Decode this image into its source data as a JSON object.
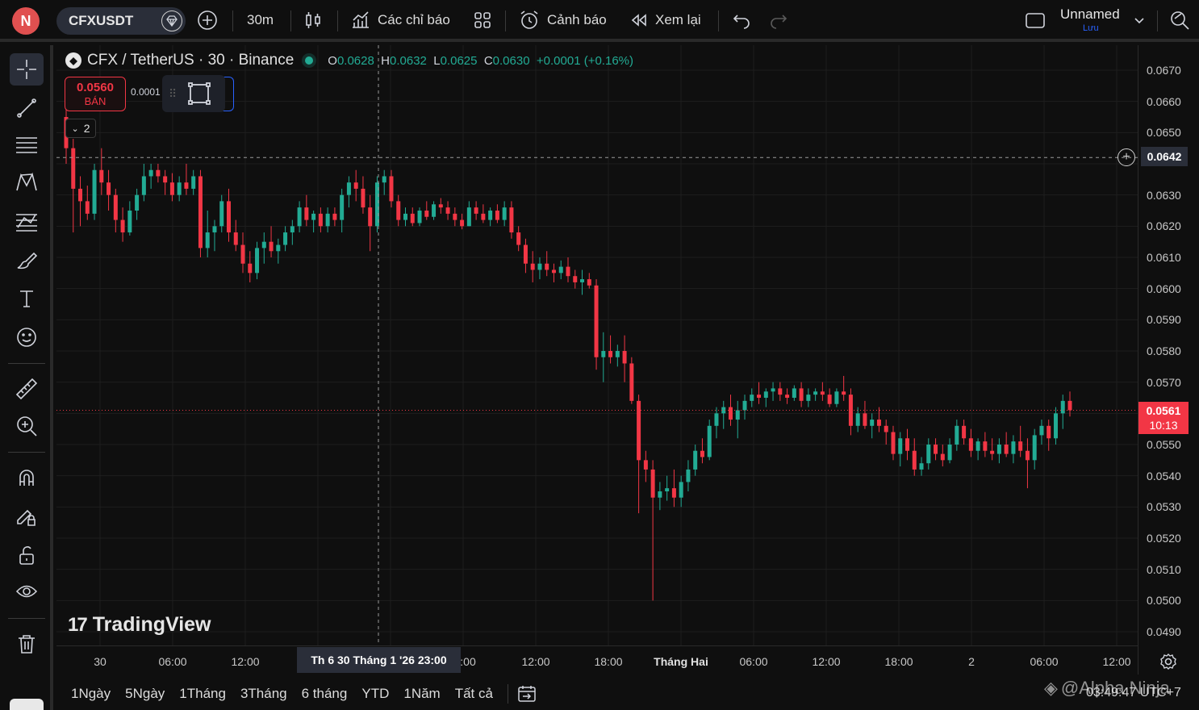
{
  "top_bar": {
    "avatar_letter": "N",
    "symbol": "CFXUSDT",
    "interval": "30m",
    "indicators_label": "Các chỉ báo",
    "alerts_label": "Cảnh báo",
    "replay_label": "Xem lại",
    "layout_name": "Unnamed",
    "layout_save": "Lưu"
  },
  "legend": {
    "title": "CFX / TetherUS · 30 · Binance",
    "o_label": "O",
    "o_value": "0.0628",
    "h_label": "H",
    "h_value": "0.0632",
    "l_label": "L",
    "l_value": "0.0625",
    "c_label": "C",
    "c_value": "0.0630",
    "change": "+0.0001 (+0.16%)"
  },
  "trade_panel": {
    "sell_price": "0.0560",
    "sell_label": "BÁN",
    "spread": "0.0001",
    "collapse_count": "2"
  },
  "watermark": "TradingView",
  "price_axis": {
    "labels": [
      "0.0670",
      "0.0660",
      "0.0650",
      "0.0630",
      "0.0620",
      "0.0610",
      "0.0600",
      "0.0590",
      "0.0580",
      "0.0570",
      "0.0550",
      "0.0540",
      "0.0530",
      "0.0520",
      "0.0510",
      "0.0500",
      "0.0490"
    ],
    "crosshair_price": "0.0642",
    "current_price": "0.0561",
    "countdown": "10:13"
  },
  "time_axis": {
    "labels": [
      "30",
      "06:00",
      "12:00",
      ":00",
      "12:00",
      "18:00",
      "Tháng Hai",
      "06:00",
      "12:00",
      "18:00",
      "2",
      "06:00",
      "12:00"
    ],
    "crosshair_time": "Th 6 30 Tháng 1 '26   23:00"
  },
  "bottom_bar": {
    "ranges": [
      "1Ngày",
      "5Ngày",
      "1Tháng",
      "3Tháng",
      "6 tháng",
      "YTD",
      "1Năm",
      "Tất cả"
    ],
    "clock": "03:49:47 UTC+7",
    "overlay_watermark": "@Alpha Ninja"
  },
  "colors": {
    "up": "#22ab94",
    "down": "#f23645",
    "background": "#0f0f0f",
    "grid": "#1e1e1e"
  },
  "chart_data": {
    "type": "candlestick",
    "interval": "30",
    "ylim": [
      0.049,
      0.0675
    ],
    "crosshair_price": 0.0642,
    "current_price": 0.0561,
    "candles": [
      [
        0.0655,
        0.066,
        0.064,
        0.0645
      ],
      [
        0.0645,
        0.0648,
        0.0618,
        0.0632
      ],
      [
        0.0632,
        0.0636,
        0.062,
        0.0628
      ],
      [
        0.0628,
        0.0633,
        0.0622,
        0.0624
      ],
      [
        0.0624,
        0.064,
        0.0622,
        0.0638
      ],
      [
        0.0638,
        0.0645,
        0.063,
        0.0634
      ],
      [
        0.0634,
        0.0638,
        0.0625,
        0.063
      ],
      [
        0.063,
        0.0632,
        0.0618,
        0.0622
      ],
      [
        0.0622,
        0.0626,
        0.0615,
        0.0618
      ],
      [
        0.0618,
        0.0628,
        0.0617,
        0.0625
      ],
      [
        0.0625,
        0.0632,
        0.0622,
        0.063
      ],
      [
        0.063,
        0.064,
        0.0628,
        0.0636
      ],
      [
        0.0636,
        0.064,
        0.0632,
        0.0638
      ],
      [
        0.0638,
        0.064,
        0.0634,
        0.0636
      ],
      [
        0.0636,
        0.0638,
        0.063,
        0.0634
      ],
      [
        0.0634,
        0.0637,
        0.0628,
        0.063
      ],
      [
        0.063,
        0.0636,
        0.0628,
        0.0634
      ],
      [
        0.0634,
        0.064,
        0.063,
        0.0632
      ],
      [
        0.0632,
        0.0638,
        0.063,
        0.0636
      ],
      [
        0.0636,
        0.0638,
        0.061,
        0.0613
      ],
      [
        0.0613,
        0.0625,
        0.061,
        0.0618
      ],
      [
        0.0618,
        0.0622,
        0.0612,
        0.062
      ],
      [
        0.062,
        0.063,
        0.0618,
        0.0628
      ],
      [
        0.0628,
        0.0632,
        0.0615,
        0.0618
      ],
      [
        0.0618,
        0.0622,
        0.0612,
        0.0614
      ],
      [
        0.0614,
        0.0618,
        0.0605,
        0.0608
      ],
      [
        0.0608,
        0.0612,
        0.0602,
        0.0605
      ],
      [
        0.0605,
        0.0615,
        0.0603,
        0.0613
      ],
      [
        0.0613,
        0.0618,
        0.0608,
        0.0615
      ],
      [
        0.0615,
        0.062,
        0.061,
        0.0612
      ],
      [
        0.0612,
        0.0616,
        0.0608,
        0.0614
      ],
      [
        0.0614,
        0.062,
        0.0612,
        0.0618
      ],
      [
        0.0618,
        0.0622,
        0.0614,
        0.062
      ],
      [
        0.062,
        0.0628,
        0.0618,
        0.0626
      ],
      [
        0.0626,
        0.063,
        0.062,
        0.0622
      ],
      [
        0.0622,
        0.0625,
        0.0618,
        0.0624
      ],
      [
        0.0624,
        0.0626,
        0.0618,
        0.062
      ],
      [
        0.062,
        0.0626,
        0.0618,
        0.0624
      ],
      [
        0.0624,
        0.0626,
        0.062,
        0.0622
      ],
      [
        0.0622,
        0.0632,
        0.0618,
        0.063
      ],
      [
        0.063,
        0.0636,
        0.0626,
        0.0634
      ],
      [
        0.0634,
        0.0638,
        0.0628,
        0.0632
      ],
      [
        0.0632,
        0.0636,
        0.0624,
        0.0626
      ],
      [
        0.0626,
        0.063,
        0.0612,
        0.062
      ],
      [
        0.062,
        0.0636,
        0.0618,
        0.0634
      ],
      [
        0.0634,
        0.0638,
        0.063,
        0.0636
      ],
      [
        0.0636,
        0.0638,
        0.0626,
        0.0628
      ],
      [
        0.0628,
        0.063,
        0.062,
        0.0622
      ],
      [
        0.0622,
        0.0626,
        0.062,
        0.0624
      ],
      [
        0.0624,
        0.0626,
        0.062,
        0.0621
      ],
      [
        0.0621,
        0.0626,
        0.062,
        0.0625
      ],
      [
        0.0625,
        0.0628,
        0.0622,
        0.0623
      ],
      [
        0.0623,
        0.0628,
        0.0622,
        0.0627
      ],
      [
        0.0627,
        0.0629,
        0.0624,
        0.0626
      ],
      [
        0.0626,
        0.0628,
        0.0622,
        0.0624
      ],
      [
        0.0624,
        0.0626,
        0.062,
        0.0622
      ],
      [
        0.0622,
        0.0624,
        0.0619,
        0.062
      ],
      [
        0.062,
        0.0628,
        0.062,
        0.0626
      ],
      [
        0.0626,
        0.0628,
        0.0622,
        0.0624
      ],
      [
        0.0624,
        0.0627,
        0.0621,
        0.0622
      ],
      [
        0.0622,
        0.0626,
        0.062,
        0.0625
      ],
      [
        0.0625,
        0.0627,
        0.0621,
        0.0622
      ],
      [
        0.0622,
        0.0628,
        0.062,
        0.0626
      ],
      [
        0.0626,
        0.0628,
        0.0616,
        0.0618
      ],
      [
        0.0618,
        0.062,
        0.0612,
        0.0614
      ],
      [
        0.0614,
        0.0616,
        0.0605,
        0.0608
      ],
      [
        0.0608,
        0.0612,
        0.0602,
        0.0606
      ],
      [
        0.0606,
        0.061,
        0.0603,
        0.0608
      ],
      [
        0.0608,
        0.0612,
        0.0604,
        0.0606
      ],
      [
        0.0606,
        0.0608,
        0.0602,
        0.0605
      ],
      [
        0.0605,
        0.0609,
        0.0603,
        0.0607
      ],
      [
        0.0607,
        0.061,
        0.0602,
        0.0604
      ],
      [
        0.0604,
        0.0606,
        0.06,
        0.0602
      ],
      [
        0.0602,
        0.0606,
        0.0598,
        0.0603
      ],
      [
        0.0603,
        0.0605,
        0.06,
        0.0601
      ],
      [
        0.0601,
        0.0603,
        0.0574,
        0.0578
      ],
      [
        0.0578,
        0.0586,
        0.057,
        0.058
      ],
      [
        0.058,
        0.0585,
        0.0576,
        0.0578
      ],
      [
        0.0578,
        0.0582,
        0.0575,
        0.058
      ],
      [
        0.058,
        0.0585,
        0.057,
        0.0576
      ],
      [
        0.0576,
        0.0578,
        0.0563,
        0.0564
      ],
      [
        0.0564,
        0.0566,
        0.0528,
        0.0545
      ],
      [
        0.0545,
        0.0548,
        0.0538,
        0.0542
      ],
      [
        0.0542,
        0.0545,
        0.05,
        0.0533
      ],
      [
        0.0533,
        0.0538,
        0.0529,
        0.0535
      ],
      [
        0.0535,
        0.054,
        0.0532,
        0.0536
      ],
      [
        0.0536,
        0.0542,
        0.053,
        0.0533
      ],
      [
        0.0533,
        0.054,
        0.053,
        0.0538
      ],
      [
        0.0538,
        0.0545,
        0.0535,
        0.0542
      ],
      [
        0.0542,
        0.055,
        0.054,
        0.0548
      ],
      [
        0.0548,
        0.0552,
        0.0544,
        0.0546
      ],
      [
        0.0546,
        0.0558,
        0.0545,
        0.0556
      ],
      [
        0.0556,
        0.0562,
        0.0552,
        0.056
      ],
      [
        0.056,
        0.0564,
        0.0555,
        0.0562
      ],
      [
        0.0562,
        0.0566,
        0.0556,
        0.0558
      ],
      [
        0.0558,
        0.0564,
        0.0552,
        0.0561
      ],
      [
        0.0561,
        0.0566,
        0.0558,
        0.0564
      ],
      [
        0.0564,
        0.0568,
        0.0562,
        0.0566
      ],
      [
        0.0566,
        0.057,
        0.0563,
        0.0565
      ],
      [
        0.0565,
        0.0568,
        0.0562,
        0.0567
      ],
      [
        0.0567,
        0.057,
        0.0564,
        0.0568
      ],
      [
        0.0568,
        0.057,
        0.0564,
        0.0566
      ],
      [
        0.0566,
        0.0568,
        0.0563,
        0.0565
      ],
      [
        0.0565,
        0.0569,
        0.0564,
        0.0568
      ],
      [
        0.0568,
        0.057,
        0.0562,
        0.0564
      ],
      [
        0.0564,
        0.0568,
        0.0562,
        0.0566
      ],
      [
        0.0566,
        0.0568,
        0.0564,
        0.0567
      ],
      [
        0.0567,
        0.057,
        0.0564,
        0.0566
      ],
      [
        0.0566,
        0.0568,
        0.0562,
        0.0563
      ],
      [
        0.0563,
        0.0568,
        0.0562,
        0.0567
      ],
      [
        0.0567,
        0.0572,
        0.0564,
        0.0566
      ],
      [
        0.0566,
        0.0568,
        0.0553,
        0.0556
      ],
      [
        0.0556,
        0.0562,
        0.0554,
        0.056
      ],
      [
        0.056,
        0.0564,
        0.0555,
        0.0556
      ],
      [
        0.0556,
        0.056,
        0.0552,
        0.0558
      ],
      [
        0.0558,
        0.0562,
        0.0554,
        0.0556
      ],
      [
        0.0556,
        0.0558,
        0.055,
        0.0554
      ],
      [
        0.0554,
        0.0556,
        0.0545,
        0.0547
      ],
      [
        0.0547,
        0.0554,
        0.0543,
        0.0552
      ],
      [
        0.0552,
        0.0555,
        0.0545,
        0.0548
      ],
      [
        0.0548,
        0.0552,
        0.054,
        0.0542
      ],
      [
        0.0542,
        0.0546,
        0.054,
        0.0544
      ],
      [
        0.0544,
        0.0552,
        0.0542,
        0.055
      ],
      [
        0.055,
        0.0552,
        0.0545,
        0.0547
      ],
      [
        0.0547,
        0.055,
        0.0543,
        0.0545
      ],
      [
        0.0545,
        0.0552,
        0.0544,
        0.055
      ],
      [
        0.055,
        0.0558,
        0.0548,
        0.0556
      ],
      [
        0.0556,
        0.0558,
        0.055,
        0.0552
      ],
      [
        0.0552,
        0.0555,
        0.0546,
        0.0548
      ],
      [
        0.0548,
        0.0552,
        0.0545,
        0.0551
      ],
      [
        0.0551,
        0.0554,
        0.0546,
        0.0548
      ],
      [
        0.0548,
        0.0552,
        0.0545,
        0.0547
      ],
      [
        0.0547,
        0.0552,
        0.0544,
        0.055
      ],
      [
        0.055,
        0.0554,
        0.0546,
        0.0547
      ],
      [
        0.0547,
        0.0553,
        0.0544,
        0.0551
      ],
      [
        0.0551,
        0.0556,
        0.0546,
        0.0548
      ],
      [
        0.0548,
        0.0552,
        0.0536,
        0.0545
      ],
      [
        0.0545,
        0.0555,
        0.0542,
        0.0553
      ],
      [
        0.0553,
        0.0558,
        0.055,
        0.0556
      ],
      [
        0.0556,
        0.0558,
        0.0548,
        0.0552
      ],
      [
        0.0552,
        0.0562,
        0.055,
        0.056
      ],
      [
        0.056,
        0.0566,
        0.0555,
        0.0564
      ],
      [
        0.0564,
        0.0567,
        0.0559,
        0.0561
      ]
    ]
  }
}
